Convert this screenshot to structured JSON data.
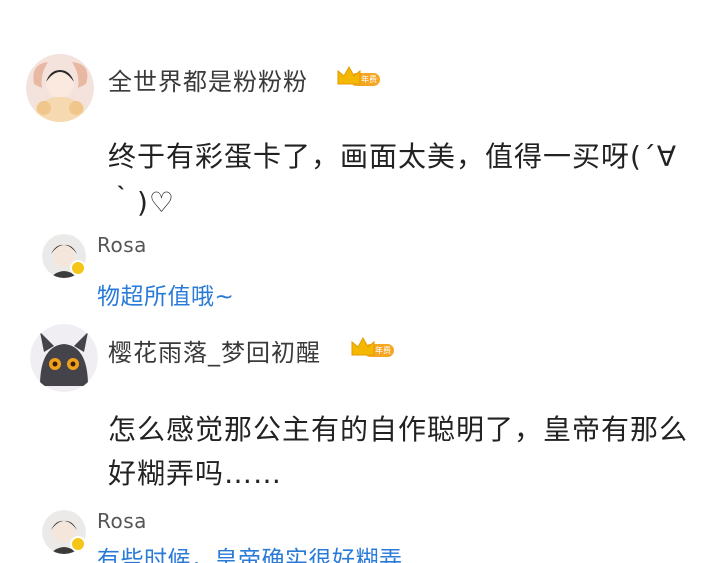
{
  "comments": [
    {
      "username": "全世界都是粉粉粉",
      "badge_label": "年费",
      "text": "终于有彩蛋卡了，画面太美，值得一买呀(´∀｀)♡",
      "reply": {
        "username": "Rosa",
        "text": "物超所值哦~"
      }
    },
    {
      "username": "樱花雨落_梦回初醒",
      "badge_label": "年费",
      "text": "怎么感觉那公主有的自作聪明了，皇帝有那么好糊弄吗……",
      "reply": {
        "username": "Rosa",
        "text": "有些时候，皇帝确实很好糊弄"
      }
    }
  ],
  "colors": {
    "reply_text": "#2a7ad8",
    "badge_gold": "#f5b800",
    "badge_orange": "#f08a24"
  },
  "icons": {
    "crown": "crown-icon",
    "verified": "verified-badge-icon"
  }
}
